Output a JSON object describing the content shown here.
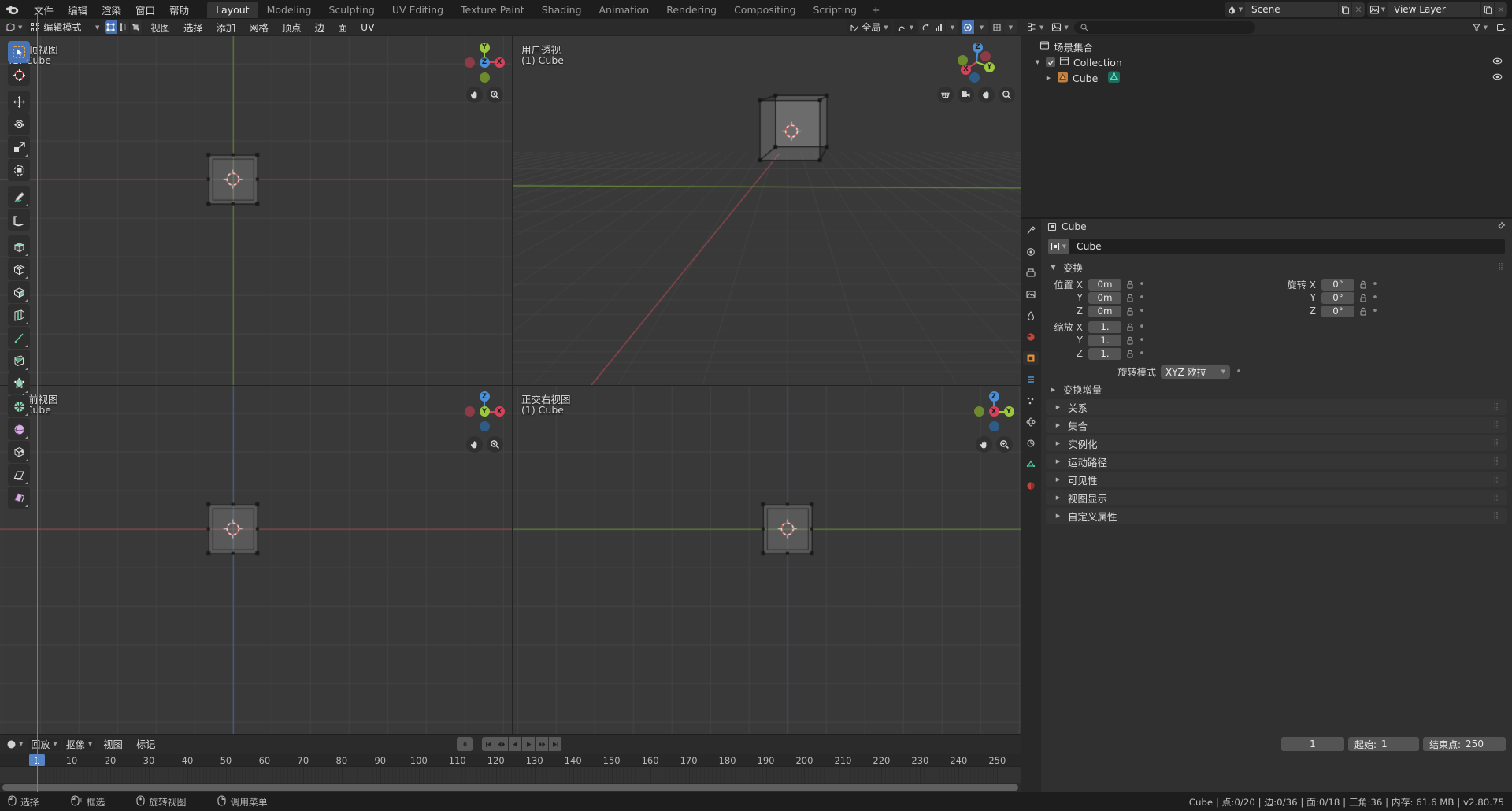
{
  "topbar": {
    "menus": [
      "文件",
      "编辑",
      "渲染",
      "窗口",
      "帮助"
    ],
    "workspace_tabs": [
      {
        "label": "Layout",
        "active": true
      },
      {
        "label": "Modeling",
        "active": false
      },
      {
        "label": "Sculpting",
        "active": false
      },
      {
        "label": "UV Editing",
        "active": false
      },
      {
        "label": "Texture Paint",
        "active": false
      },
      {
        "label": "Shading",
        "active": false
      },
      {
        "label": "Animation",
        "active": false
      },
      {
        "label": "Rendering",
        "active": false
      },
      {
        "label": "Compositing",
        "active": false
      },
      {
        "label": "Scripting",
        "active": false
      }
    ],
    "add_tab": "+",
    "scene_name": "Scene",
    "view_layer_name": "View Layer"
  },
  "viewport_header": {
    "mode": "编辑模式",
    "menus": [
      "视图",
      "选择",
      "添加",
      "网格",
      "顶点",
      "边",
      "面",
      "UV"
    ],
    "transform_orientation": "全局"
  },
  "viewports": [
    {
      "name": "正交顶视图",
      "object": "(1) Cube",
      "kind": "top"
    },
    {
      "name": "用户透视",
      "object": "(1) Cube",
      "kind": "persp"
    },
    {
      "name": "正交前视图",
      "object": "(1) Cube",
      "kind": "front"
    },
    {
      "name": "正交右视图",
      "object": "(1) Cube",
      "kind": "right"
    }
  ],
  "outliner": {
    "scene_collection": "场景集合",
    "items": [
      {
        "label": "Collection",
        "depth": 0,
        "type": "collection"
      },
      {
        "label": "Cube",
        "depth": 1,
        "type": "object"
      }
    ]
  },
  "properties": {
    "breadcrumb": "Cube",
    "object_name": "Cube",
    "transform_panel": "变换",
    "location_label": "位置 X",
    "rotation_label": "旋转 X",
    "scale_label": "缩放 X",
    "axis_y": "Y",
    "axis_z": "Z",
    "location": [
      "0m",
      "0m",
      "0m"
    ],
    "rotation": [
      "0°",
      "0°",
      "0°"
    ],
    "scale": [
      "1.",
      "1.",
      "1."
    ],
    "rotation_mode_label": "旋转模式",
    "rotation_mode_value": "XYZ 欧拉",
    "delta_transform": "变换增量",
    "panels": [
      "关系",
      "集合",
      "实例化",
      "运动路径",
      "可见性",
      "视图显示",
      "自定义属性"
    ]
  },
  "timeline": {
    "menus": [
      "回放",
      "抠像",
      "视图",
      "标记"
    ],
    "current_frame": "1",
    "start_label": "起始:",
    "start_value": "1",
    "end_label": "结束点:",
    "end_value": "250",
    "ticks": [
      1,
      10,
      20,
      30,
      40,
      50,
      60,
      70,
      80,
      90,
      100,
      110,
      120,
      130,
      140,
      150,
      160,
      170,
      180,
      190,
      200,
      210,
      220,
      230,
      240,
      250
    ]
  },
  "statusbar": {
    "hints": [
      {
        "icon": "mouse-left",
        "label": "选择"
      },
      {
        "icon": "mouse-left-drag",
        "label": "框选"
      },
      {
        "icon": "mouse-middle",
        "label": "旋转视图"
      },
      {
        "icon": "mouse-right",
        "label": "调用菜单"
      }
    ],
    "info": "Cube | 点:0/20 | 边:0/36 | 面:0/18 | 三角:36  | 内存: 61.6 MB | v2.80.75"
  },
  "toolbar_icons": [
    "tweak-select-tool",
    "cursor-tool",
    "move-tool",
    "rotate-tool",
    "scale-tool",
    "transform-tool",
    "annotate-tool",
    "measure-tool",
    "extrude-region-tool",
    "inset-faces-tool",
    "bevel-tool",
    "loop-cut-tool",
    "knife-tool",
    "poly-build-tool",
    "spin-tool",
    "smooth-tool",
    "edge-slide-tool",
    "shrink-fatten-tool",
    "shear-tool",
    "rip-region-tool"
  ],
  "colors": {
    "accent": "#4772b3",
    "axis_x": "#d9415a",
    "axis_y": "#9bc93a",
    "axis_z": "#4b8fd4",
    "background": "#393939",
    "panel": "#303030",
    "header": "#2b2b2b"
  }
}
